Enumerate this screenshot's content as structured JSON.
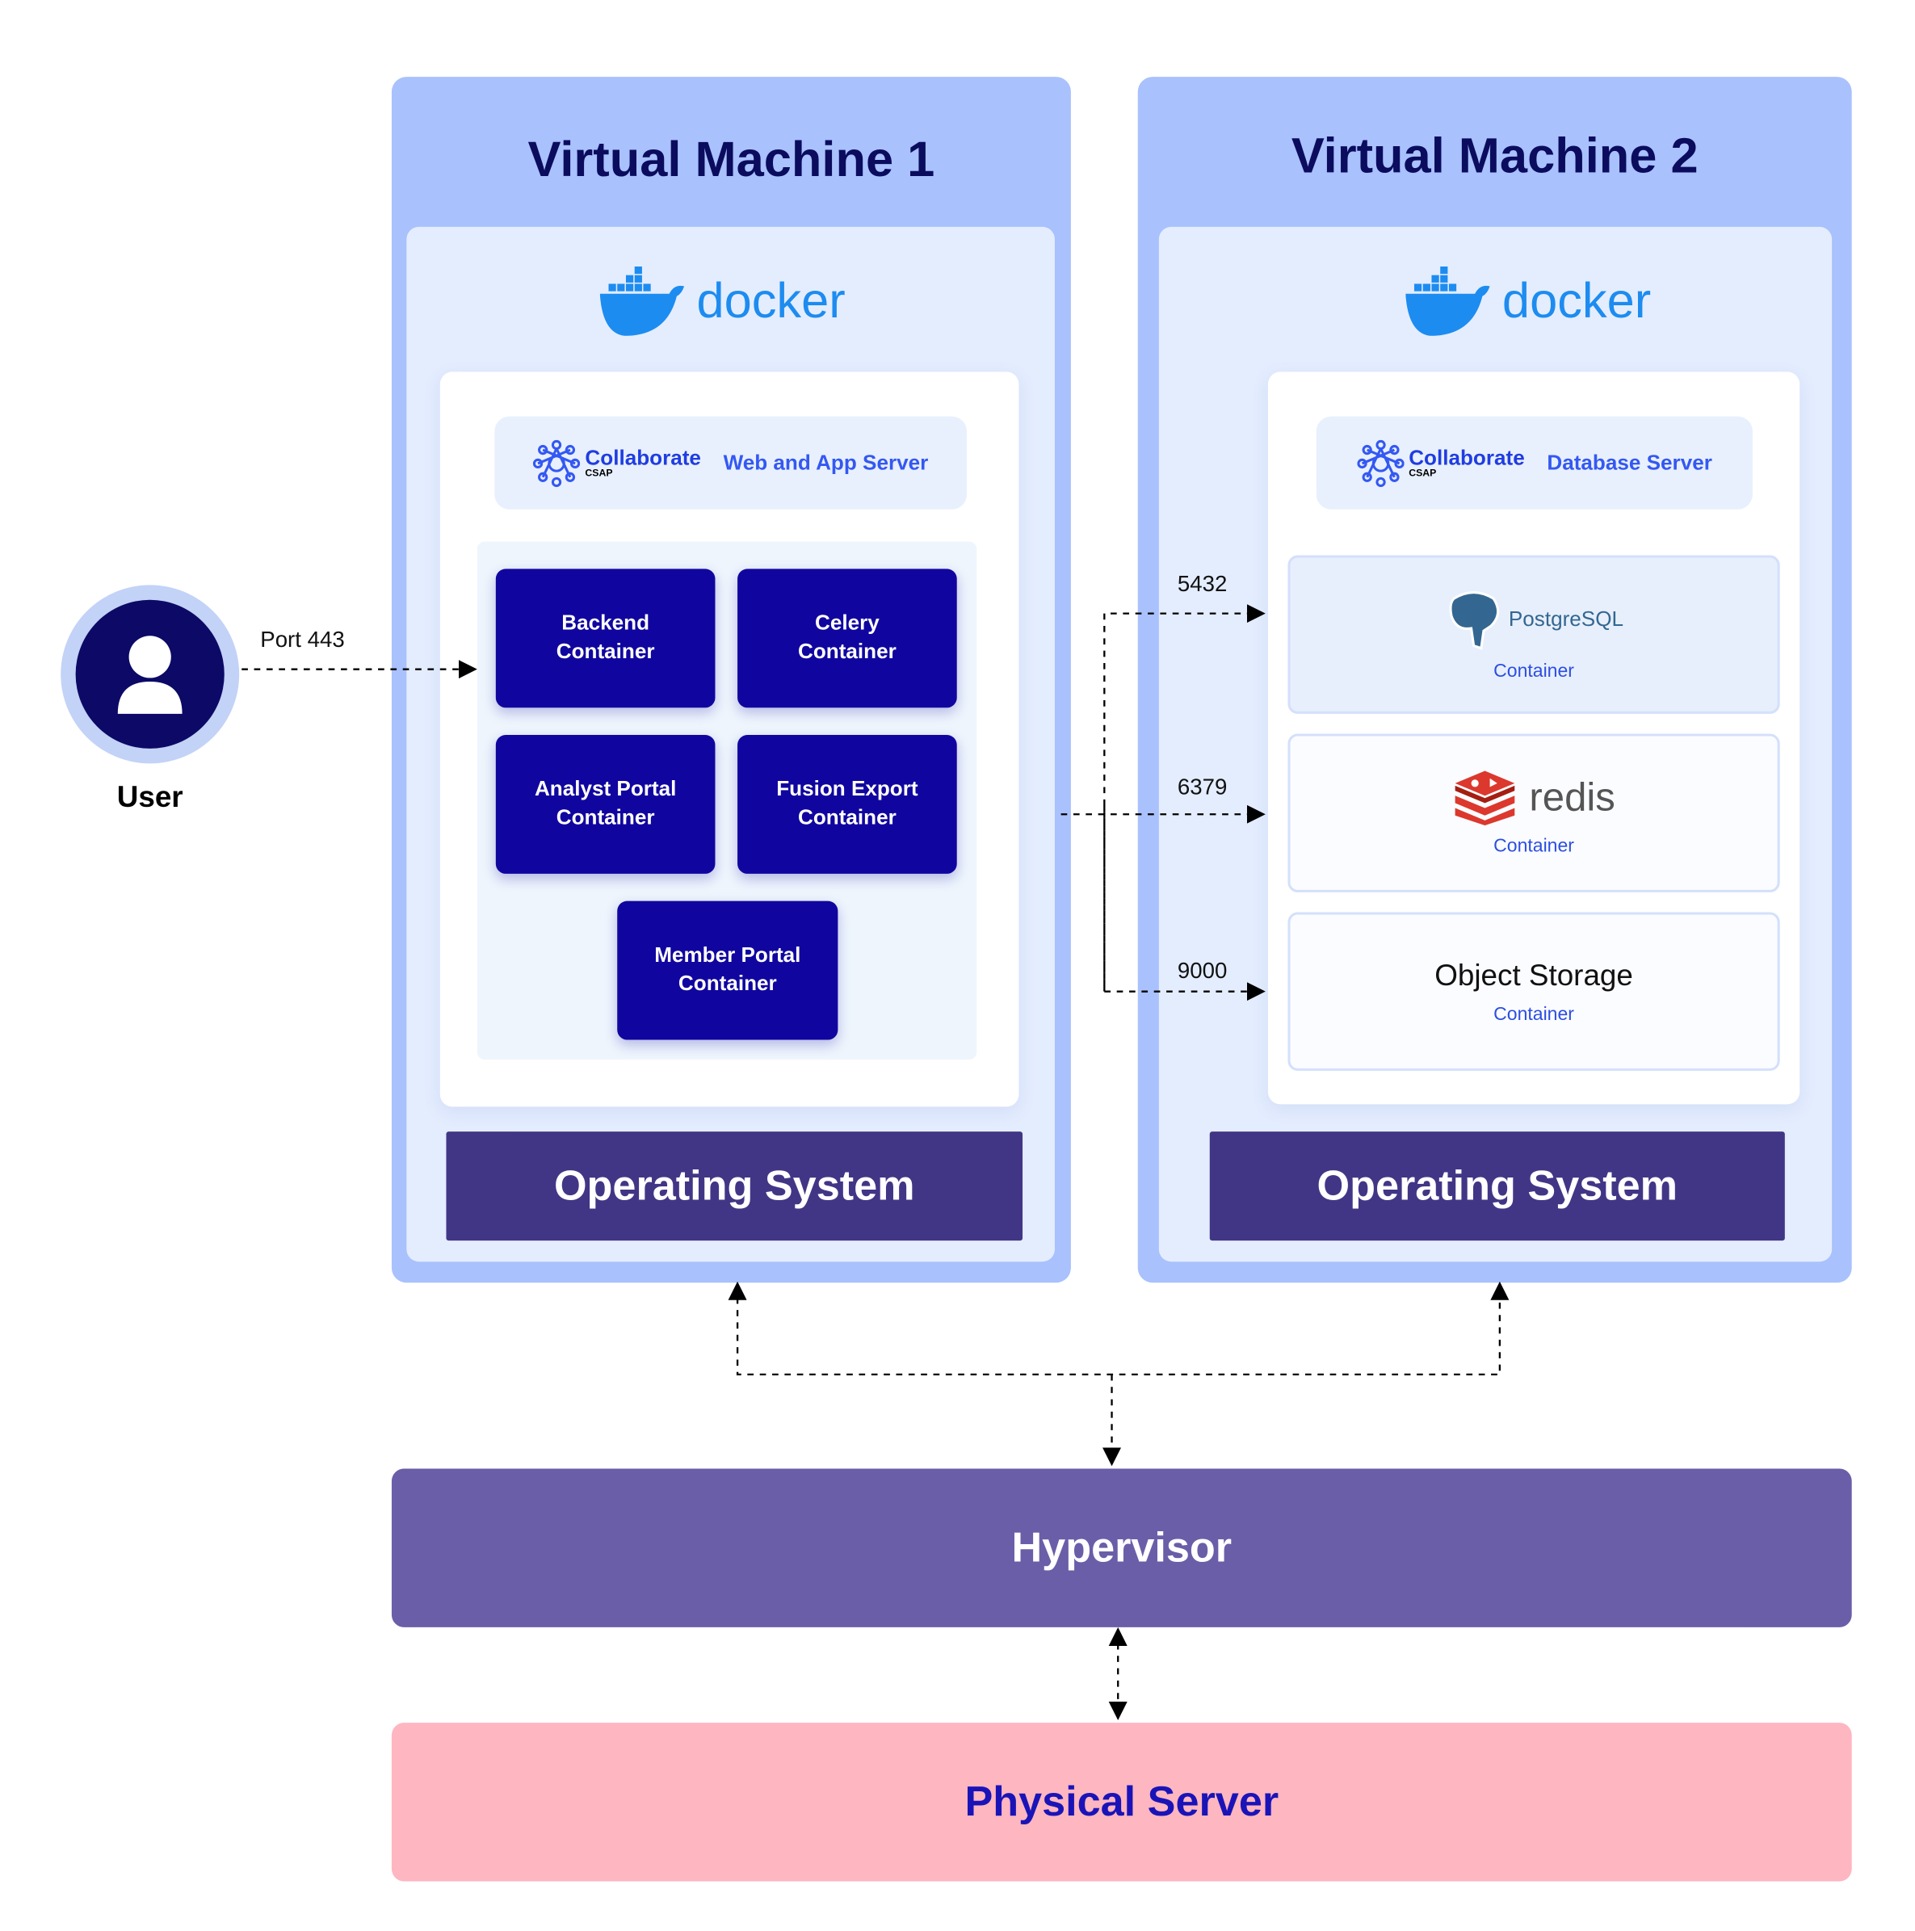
{
  "user": {
    "label": "User",
    "port_label": "Port 443"
  },
  "vm1": {
    "title": "Virtual Machine 1",
    "docker_label": "docker",
    "brand": {
      "name": "Collaborate",
      "sub": "CSAP"
    },
    "server_label": "Web and App Server",
    "containers": [
      {
        "line1": "Backend",
        "line2": "Container"
      },
      {
        "line1": "Celery",
        "line2": "Container"
      },
      {
        "line1": "Analyst Portal",
        "line2": "Container"
      },
      {
        "line1": "Fusion Export",
        "line2": "Container"
      },
      {
        "line1": "Member Portal",
        "line2": "Container"
      }
    ],
    "os_label": "Operating System"
  },
  "vm2": {
    "title": "Virtual Machine 2",
    "docker_label": "docker",
    "brand": {
      "name": "Collaborate",
      "sub": "CSAP"
    },
    "server_label": "Database Server",
    "containers": [
      {
        "name": "PostgreSQL",
        "sub": "Container",
        "port": "5432"
      },
      {
        "name": "redis",
        "sub": "Container",
        "port": "6379"
      },
      {
        "name": "Object Storage",
        "sub": "Container",
        "port": "9000"
      }
    ],
    "os_label": "Operating System"
  },
  "hypervisor": {
    "label": "Hypervisor",
    "color": "#6b5ea8"
  },
  "physical": {
    "label": "Physical Server",
    "color": "#feb6c0"
  },
  "colors": {
    "vm": "#a9c1fd",
    "container": "#10069f",
    "os": "#413686",
    "docker": "#1d8cf0"
  }
}
